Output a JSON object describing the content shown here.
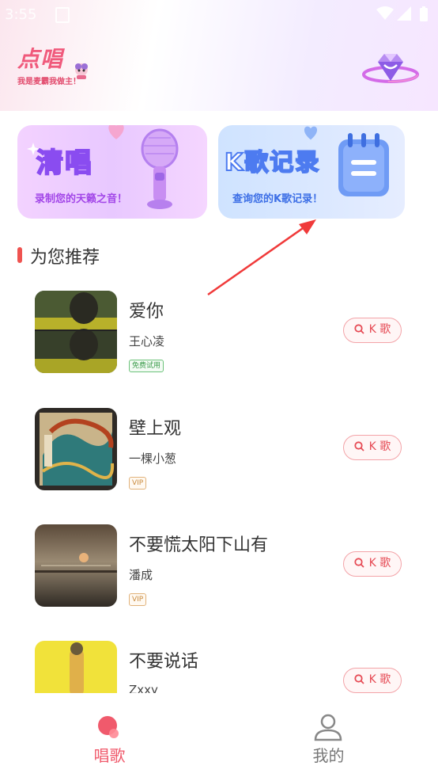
{
  "status_bar": {
    "time": "3:55"
  },
  "header": {
    "logo_title": "点唱",
    "logo_slogan": "我是麦霸我做主！",
    "icons": {
      "mascot": "mascot-icon",
      "vip": "diamond-crown-icon"
    }
  },
  "banners": [
    {
      "title": "清唱",
      "subtitle": "录制您的天籁之音！",
      "icon": "microphone-icon"
    },
    {
      "title": "K歌记录",
      "subtitle": "查询您的K歌记录！",
      "icon": "notebook-icon"
    }
  ],
  "section": {
    "title": "为您推荐"
  },
  "songs": [
    {
      "name": "爱你",
      "artist": "王心凌",
      "badge": "免费试用",
      "badge_type": "free",
      "button": "K 歌"
    },
    {
      "name": "壁上观",
      "artist": "一棵小葱",
      "badge": "VIP",
      "badge_type": "vip",
      "button": "K 歌"
    },
    {
      "name": "不要慌太阳下山有",
      "artist": "潘成",
      "badge": "VIP",
      "badge_type": "vip",
      "button": "K 歌"
    },
    {
      "name": "不要说话",
      "artist": "Zxxy",
      "badge": "",
      "badge_type": "",
      "button": "K 歌"
    }
  ],
  "tabs": [
    {
      "label": "唱歌",
      "icon": "sing-icon",
      "active": true
    },
    {
      "label": "我的",
      "icon": "profile-icon",
      "active": false
    }
  ],
  "colors": {
    "accent": "#f05a6c",
    "k_button_border": "#f3a3a8",
    "section_bar": "#ef5350",
    "banner_purple": "#8a4cf0",
    "banner_blue": "#4d7bf0"
  }
}
